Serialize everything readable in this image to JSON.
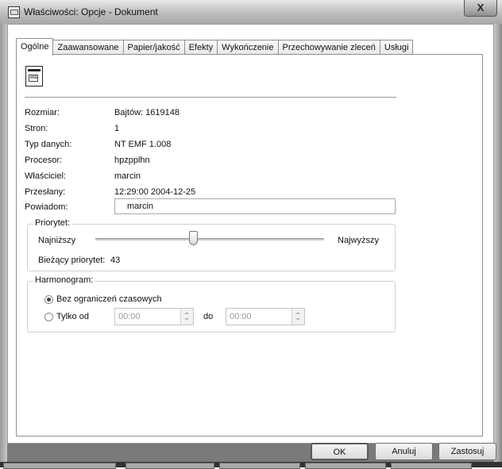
{
  "window": {
    "title": "Właściwości: Opcje - Dokument",
    "close_glyph": "X"
  },
  "tabs": [
    {
      "label": "Ogólne",
      "active": true
    },
    {
      "label": "Zaawansowane",
      "active": false
    },
    {
      "label": "Papier/jakość",
      "active": false
    },
    {
      "label": "Efekty",
      "active": false
    },
    {
      "label": "Wykończenie",
      "active": false
    },
    {
      "label": "Przechowywanie zleceń",
      "active": false
    },
    {
      "label": "Usługi",
      "active": false
    }
  ],
  "details": [
    {
      "label": "Rozmiar:",
      "value": "Bajtów: 1619148"
    },
    {
      "label": "Stron:",
      "value": "1"
    },
    {
      "label": "Typ danych:",
      "value": "NT EMF 1.008"
    },
    {
      "label": "Procesor:",
      "value": "hpzpplhn"
    },
    {
      "label": "Właściciel:",
      "value": "marcin"
    },
    {
      "label": "Przesłany:",
      "value": "12:29:00  2004-12-25"
    }
  ],
  "notify": {
    "label": "Powiadom:",
    "value": "marcin"
  },
  "priority": {
    "group_title": "Priorytet:",
    "min_label": "Najniższy",
    "max_label": "Najwyższy",
    "current_label": "Bieżący priorytet:",
    "current_value": "43",
    "slider_fraction": 0.43
  },
  "schedule": {
    "group_title": "Harmonogram:",
    "option_unrestricted": "Bez ograniczeń czasowych",
    "option_from": "Tylko od",
    "selected": "unrestricted",
    "from_time": "00:00",
    "to_label": "do",
    "to_time": "00:00"
  },
  "buttons": {
    "ok": "OK",
    "cancel": "Anuluj",
    "apply": "Zastosuj"
  }
}
